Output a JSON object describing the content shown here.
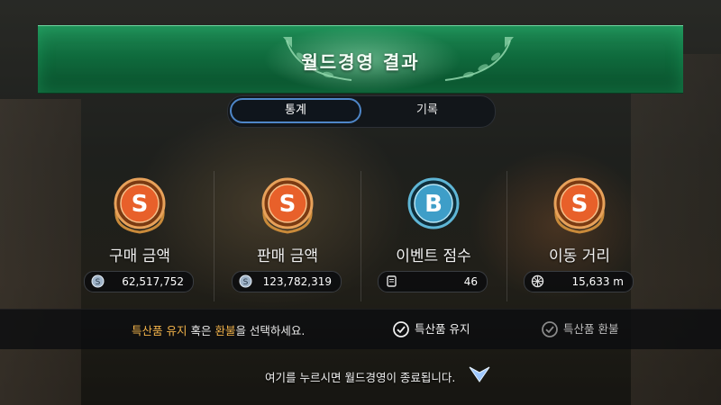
{
  "banner": {
    "title": "월드경영 결과"
  },
  "tabs": [
    {
      "label": "통계",
      "active": true
    },
    {
      "label": "기록",
      "active": false
    }
  ],
  "stats": [
    {
      "grade": "S",
      "label": "구매 금액",
      "value": "62,517,752",
      "icon": "silver-coin-icon"
    },
    {
      "grade": "S",
      "label": "판매 금액",
      "value": "123,782,319",
      "icon": "silver-coin-icon"
    },
    {
      "grade": "B",
      "label": "이벤트 점수",
      "value": "46",
      "icon": "scroll-icon"
    },
    {
      "grade": "S",
      "label": "이동 거리",
      "value": "15,633 m",
      "icon": "wheel-icon"
    }
  ],
  "choice": {
    "text_part1": "특산품 유지",
    "text_part2": " 혹은 ",
    "text_part3": "환불",
    "text_part4": "을 선택하세요.",
    "keep_label": "특산품 유지",
    "refund_label": "특산품 환불"
  },
  "footer": {
    "text": "여기를 누르시면 월드경영이 종료됩니다."
  },
  "colors": {
    "banner_green": "#0f6b3d",
    "grade_s": "#e8602a",
    "grade_b": "#3e9ec8",
    "highlight": "#f2b34a",
    "tab_active_border": "#4e86c8",
    "arrow_blue": "#9ec8ff"
  }
}
